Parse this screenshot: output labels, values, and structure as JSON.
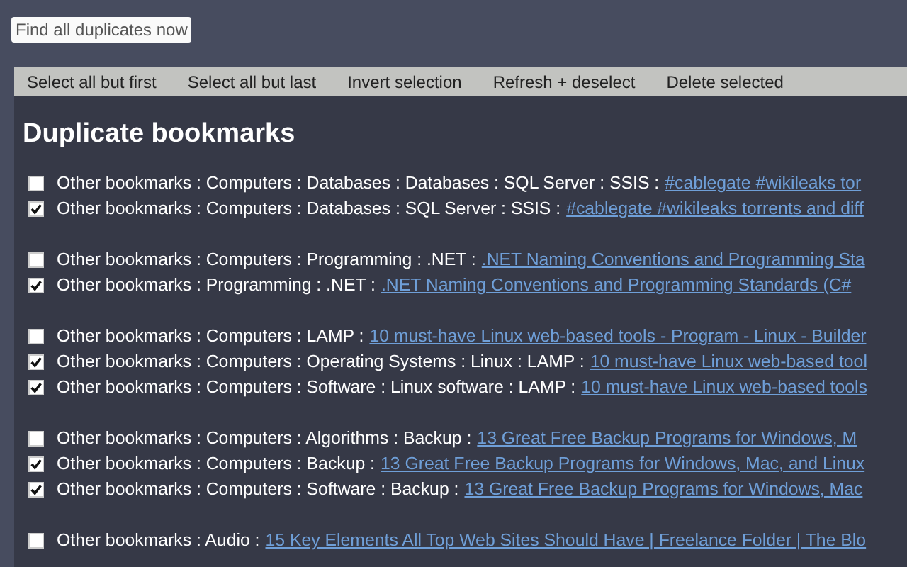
{
  "find_button": "Find all duplicates now",
  "toolbar": [
    "Select all but first",
    "Select all but last",
    "Invert selection",
    "Refresh + deselect",
    "Delete selected"
  ],
  "heading": "Duplicate bookmarks",
  "groups": [
    {
      "items": [
        {
          "checked": false,
          "path": "Other bookmarks : Computers : Databases : Databases : SQL Server : SSIS :",
          "link": "#cablegate #wikileaks tor"
        },
        {
          "checked": true,
          "path": "Other bookmarks : Computers : Databases : SQL Server : SSIS :",
          "link": "#cablegate #wikileaks torrents and diff"
        }
      ]
    },
    {
      "items": [
        {
          "checked": false,
          "path": "Other bookmarks : Computers : Programming : .NET :",
          "link": ".NET Naming Conventions and Programming Sta"
        },
        {
          "checked": true,
          "path": "Other bookmarks : Programming : .NET :",
          "link": ".NET Naming Conventions and Programming Standards (C#"
        }
      ]
    },
    {
      "items": [
        {
          "checked": false,
          "path": "Other bookmarks : Computers : LAMP :",
          "link": "10 must-have Linux web-based tools - Program - Linux - Builder"
        },
        {
          "checked": true,
          "path": "Other bookmarks : Computers : Operating Systems : Linux : LAMP :",
          "link": "10 must-have Linux web-based tool"
        },
        {
          "checked": true,
          "path": "Other bookmarks : Computers : Software : Linux software : LAMP :",
          "link": "10 must-have Linux web-based tools"
        }
      ]
    },
    {
      "items": [
        {
          "checked": false,
          "path": "Other bookmarks : Computers : Algorithms : Backup :",
          "link": "13 Great Free Backup Programs for Windows, M"
        },
        {
          "checked": true,
          "path": "Other bookmarks : Computers : Backup :",
          "link": "13 Great Free Backup Programs for Windows, Mac, and Linux"
        },
        {
          "checked": true,
          "path": "Other bookmarks : Computers : Software : Backup :",
          "link": "13 Great Free Backup Programs for Windows, Mac"
        }
      ]
    },
    {
      "items": [
        {
          "checked": false,
          "path": "Other bookmarks : Audio :",
          "link": "15 Key Elements All Top Web Sites Should Have | Freelance Folder | The Blo"
        }
      ]
    }
  ]
}
